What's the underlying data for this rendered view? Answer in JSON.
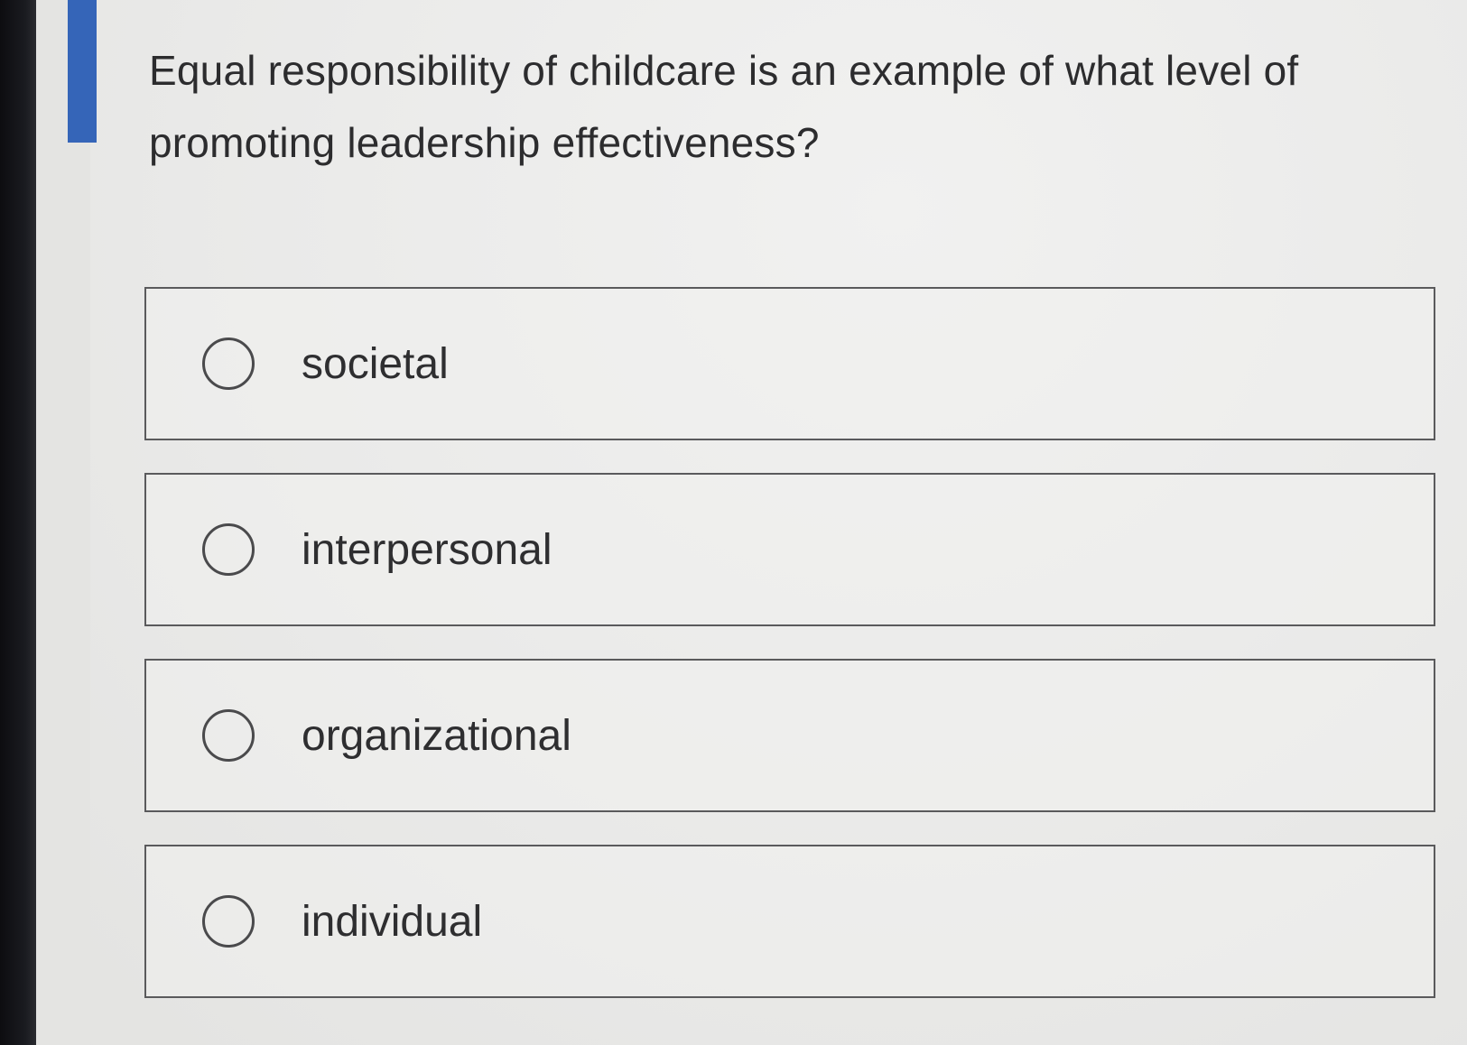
{
  "question": {
    "text": "Equal responsibility of childcare is an example of what level of promoting leadership effectiveness?"
  },
  "options": [
    {
      "label": "societal",
      "selected": false
    },
    {
      "label": "interpersonal",
      "selected": false
    },
    {
      "label": "organizational",
      "selected": false
    },
    {
      "label": "individual",
      "selected": false
    }
  ],
  "colors": {
    "accent": "#3565b8",
    "border": "#5a5a5c",
    "text": "#2c2c2e",
    "background": "#ebebea"
  }
}
